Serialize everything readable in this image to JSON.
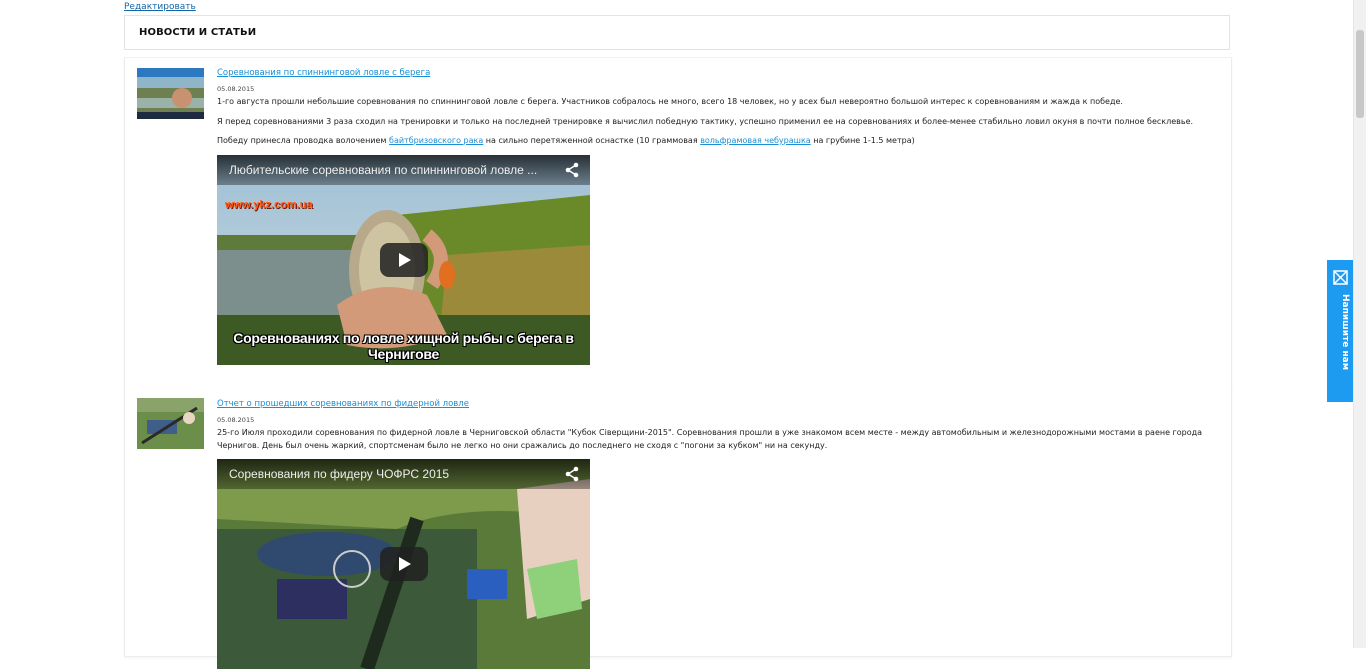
{
  "edit_link": "Редактировать",
  "section": {
    "title": "НОВОСТИ И СТАТЬИ"
  },
  "articles": [
    {
      "title": "Соревнования по спиннинговой ловле с берега",
      "date": "05.08.2015",
      "p1": "1-го августа прошли небольшие соревнования по спиннинговой ловле с берега. Участников собралось не много, всего 18 человек, но у всех был невероятно большой интерес к соревнованиям и жажда к победе.",
      "p2": "Я перед соревнованиями 3 раза сходил на тренировки и только на последней тренировке я вычислил победную тактику, успешно применил ее на соревнованиях и более-менее стабильно ловил окуня в почти полное бесклевье.",
      "p3_a": "Победу принесла проводка волочением ",
      "p3_link1": "байтбризовского рака",
      "p3_b": " на сильно перетяженной оснастке (10 граммовая ",
      "p3_link2": "вольфрамовая чебурашка",
      "p3_c": " на грубине 1-1.5 метра)",
      "video": {
        "title": "Любительские соревнования по спиннинговой ловле ...",
        "watermark": "www.ykz.com.ua",
        "caption": "Соревнованиях по ловле хищной рыбы с берега в Чернигове"
      }
    },
    {
      "title": "Отчет о прошедших соревнованиях по фидерной ловле",
      "date": "05.08.2015",
      "p1": "25-го Июля проходили соревнования по фидерной ловле в Черниговской области \"Кубок Сіверщини-2015\". Соревнования прошли в уже знакомом всем месте - между автомобильным и железнодорожными мостами в раене города Чернигов. День был очень жаркий, спортсменам было не легко но они сражались до последнего не сходя с \"погони за кубком\" ни на секунду.",
      "video": {
        "title": "Соревнования по фидеру ЧОФРС 2015"
      }
    }
  ],
  "feedback": {
    "label": "Напишите нам"
  },
  "icons": {
    "share": "share-icon",
    "play": "play-icon",
    "feedback": "envelope-icon"
  },
  "colors": {
    "link": "#1a8fd6",
    "feedback_tab": "#1d9bf0"
  }
}
